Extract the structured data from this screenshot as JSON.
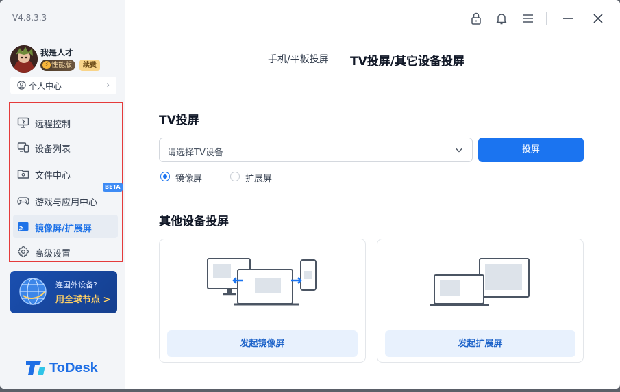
{
  "app": {
    "version": "V4.8.3.3",
    "brand": "ToDesk"
  },
  "profile": {
    "name": "我是人才",
    "badge_perf": "性能版",
    "badge_renew": "续费",
    "personal_center": "个人中心"
  },
  "nav": {
    "items": [
      {
        "label": "远程控制",
        "icon": "remote-control-icon"
      },
      {
        "label": "设备列表",
        "icon": "device-list-icon"
      },
      {
        "label": "文件中心",
        "icon": "folder-icon"
      },
      {
        "label": "游戏与应用中心",
        "icon": "gamepad-icon"
      },
      {
        "label": "镜像屏/扩展屏",
        "icon": "cast-icon"
      },
      {
        "label": "高级设置",
        "icon": "gear-icon"
      }
    ],
    "beta": "BETA",
    "active_index": 4
  },
  "promo": {
    "line1": "连国外设备?",
    "line2": "用全球节点 >"
  },
  "tabs": [
    {
      "label": "手机/平板投屏",
      "active": false
    },
    {
      "label": "TV投屏/其它设备投屏",
      "active": true
    }
  ],
  "tv": {
    "title": "TV投屏",
    "select_placeholder": "请选择TV设备",
    "cast_button": "投屏",
    "radio_mirror": "镜像屏",
    "radio_extend": "扩展屏"
  },
  "other": {
    "title": "其他设备投屏",
    "mirror_button": "发起镜像屏",
    "extend_button": "发起扩展屏"
  },
  "colors": {
    "accent": "#1b74f0",
    "highlight_border": "#e53b3b",
    "sidebar_bg": "#f3f5f8"
  }
}
